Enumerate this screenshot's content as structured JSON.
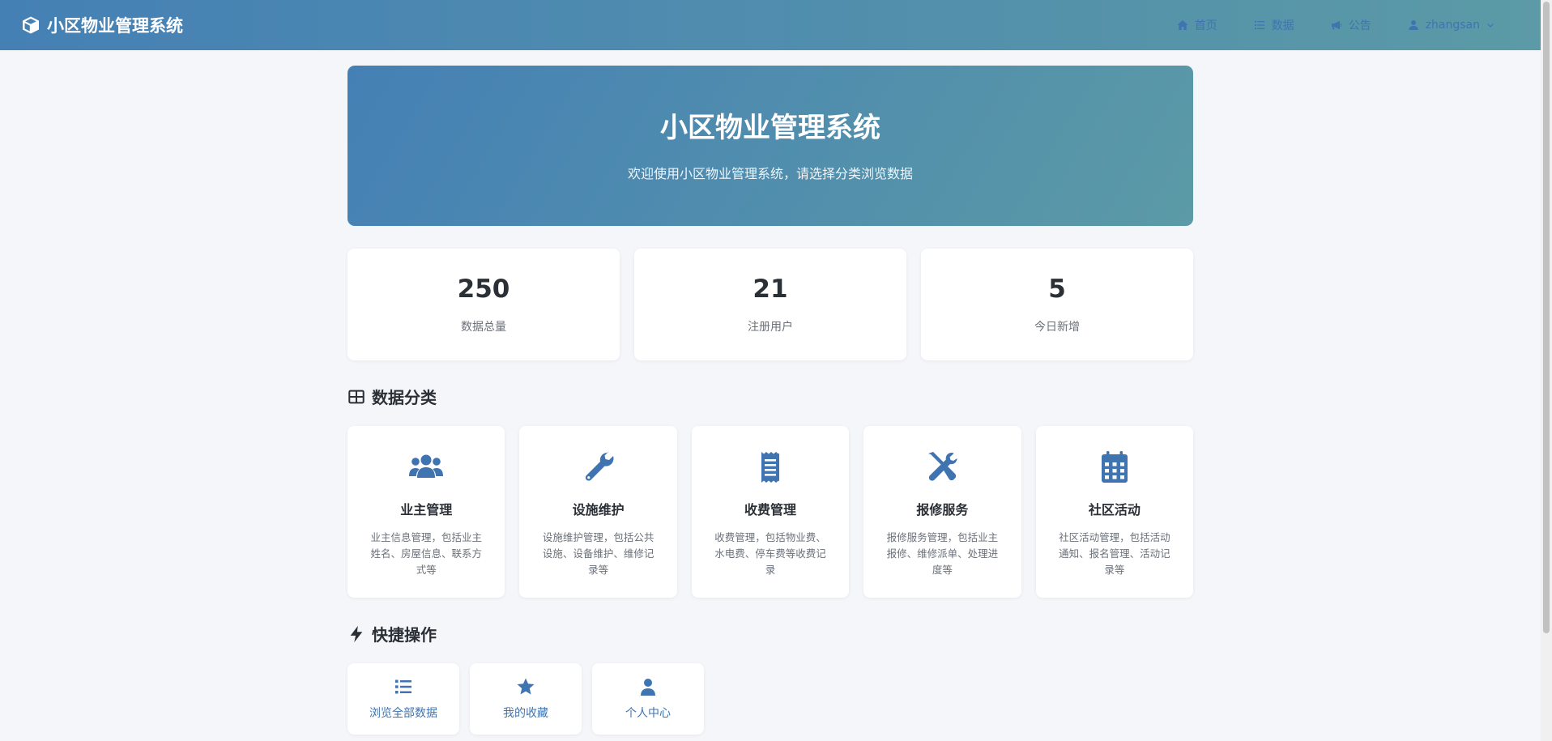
{
  "navbar": {
    "brand_icon": "cube-icon",
    "brand": "小区物业管理系统",
    "links": [
      {
        "icon": "home-icon",
        "label": "首页"
      },
      {
        "icon": "list-icon",
        "label": "数据"
      },
      {
        "icon": "megaphone-icon",
        "label": "公告"
      },
      {
        "icon": "user-icon",
        "label": "zhangsan"
      }
    ]
  },
  "hero": {
    "title": "小区物业管理系统",
    "subtitle": "欢迎使用小区物业管理系统，请选择分类浏览数据"
  },
  "stats": [
    {
      "value": "250",
      "label": "数据总量"
    },
    {
      "value": "21",
      "label": "注册用户"
    },
    {
      "value": "5",
      "label": "今日新增"
    }
  ],
  "categories_section": {
    "icon": "table-icon",
    "title": "数据分类",
    "items": [
      {
        "icon": "users-icon",
        "title": "业主管理",
        "desc": "业主信息管理，包括业主姓名、房屋信息、联系方式等"
      },
      {
        "icon": "wrench-icon",
        "title": "设施维护",
        "desc": "设施维护管理，包括公共设施、设备维护、维修记录等"
      },
      {
        "icon": "receipt-icon",
        "title": "收费管理",
        "desc": "收费管理，包括物业费、水电费、停车费等收费记录"
      },
      {
        "icon": "tools-icon",
        "title": "报修服务",
        "desc": "报修服务管理，包括业主报修、维修派单、处理进度等"
      },
      {
        "icon": "calendar-icon",
        "title": "社区活动",
        "desc": "社区活动管理，包括活动通知、报名管理、活动记录等"
      }
    ]
  },
  "quick_section": {
    "icon": "bolt-icon",
    "title": "快捷操作",
    "items": [
      {
        "icon": "list-icon",
        "label": "浏览全部数据"
      },
      {
        "icon": "star-icon",
        "label": "我的收藏"
      },
      {
        "icon": "user-icon",
        "label": "个人中心"
      }
    ]
  },
  "colors": {
    "accent": "#3f74b0",
    "gradient_start": "#4580b5",
    "gradient_end": "#5b9aa6",
    "background": "#f4f6f9"
  }
}
